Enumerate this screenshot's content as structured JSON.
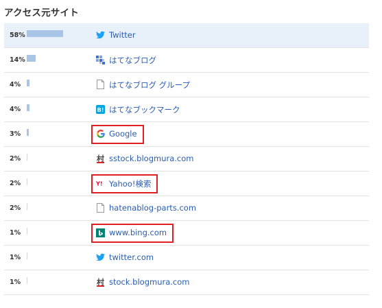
{
  "heading": "アクセス元サイト",
  "rows": [
    {
      "pct": "58%",
      "value": 58,
      "icon": "twitter-icon",
      "name": "Twitter",
      "highlighted": true,
      "boxed": false
    },
    {
      "pct": "14%",
      "value": 14,
      "icon": "hatena-blog-icon",
      "name": "はてなブログ",
      "highlighted": false,
      "boxed": false
    },
    {
      "pct": "4%",
      "value": 4,
      "icon": "document-icon",
      "name": "はてなブログ グループ",
      "highlighted": false,
      "boxed": false
    },
    {
      "pct": "4%",
      "value": 4,
      "icon": "hatena-bookmark-icon",
      "name": "はてなブックマーク",
      "highlighted": false,
      "boxed": false
    },
    {
      "pct": "3%",
      "value": 3,
      "icon": "google-icon",
      "name": "Google",
      "highlighted": false,
      "boxed": true
    },
    {
      "pct": "2%",
      "value": 2,
      "icon": "blogmura-icon",
      "name": "sstock.blogmura.com",
      "highlighted": false,
      "boxed": false
    },
    {
      "pct": "2%",
      "value": 2,
      "icon": "yahoo-icon",
      "name": "Yahoo!検索",
      "highlighted": false,
      "boxed": true
    },
    {
      "pct": "2%",
      "value": 2,
      "icon": "document-icon",
      "name": "hatenablog-parts.com",
      "highlighted": false,
      "boxed": false
    },
    {
      "pct": "1%",
      "value": 1,
      "icon": "bing-icon",
      "name": "www.bing.com",
      "highlighted": false,
      "boxed": true
    },
    {
      "pct": "1%",
      "value": 1,
      "icon": "twitter-icon",
      "name": "twitter.com",
      "highlighted": false,
      "boxed": false
    },
    {
      "pct": "1%",
      "value": 1,
      "icon": "blogmura-icon",
      "name": "stock.blogmura.com",
      "highlighted": false,
      "boxed": false
    }
  ],
  "colors": {
    "highlight_row": "#e8f1f9",
    "bar": "#a9c6e6",
    "link": "#2a5db0",
    "annotation_box": "#e02020",
    "divider": "#e2e2e2"
  }
}
